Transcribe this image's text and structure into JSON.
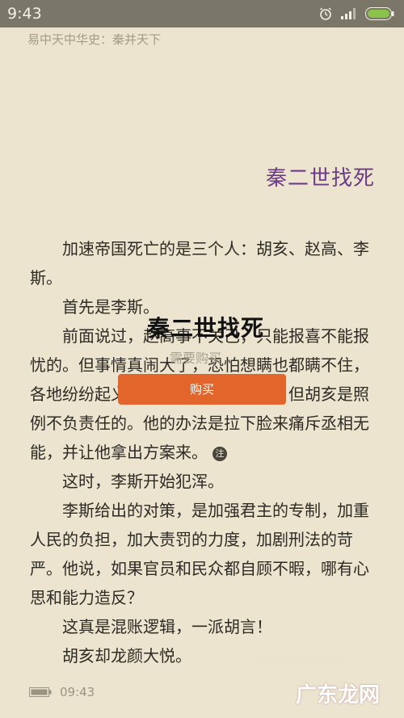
{
  "status": {
    "time": "9:43"
  },
  "book": {
    "title": "易中天中华史：秦并天下"
  },
  "chapter": {
    "title": "秦二世找死"
  },
  "paragraphs": [
    "加速帝国死亡的是三个人：胡亥、赵高、李斯。",
    "首先是李斯。",
    "前面说过，赵高事不关己，只能报喜不能报忧的。但事情真闹大了，恐怕想瞒也都瞒不住，各地纷纷起义的消息不断传入宫中。但胡亥是照例不负责任的。他的办法是拉下脸来痛斥丞相无能，并让他拿出方案来。",
    "这时，李斯开始犯浑。",
    "李斯给出的对策，是加强君主的专制，加重人民的负担，加大责罚的力度，加剧刑法的苛严。他说，如果官员和民众都自顾不暇，哪有心思和能力造反？",
    "这真是混账逻辑，一派胡言！",
    "胡亥却龙颜大悦。"
  ],
  "note_label": "注",
  "overlay": {
    "title": "秦二世找死",
    "subtitle": "需要购买",
    "buy_label": "购买"
  },
  "footer": {
    "time": "09:43"
  },
  "watermark": {
    "text": "广东龙网",
    "small": "Jingyan.baidu.com"
  },
  "colors": {
    "accent": "#e2652c",
    "chapter": "#6c3b86",
    "background": "#ece4cf"
  },
  "icons": [
    "alarm-icon",
    "signal-icon",
    "battery-icon"
  ]
}
